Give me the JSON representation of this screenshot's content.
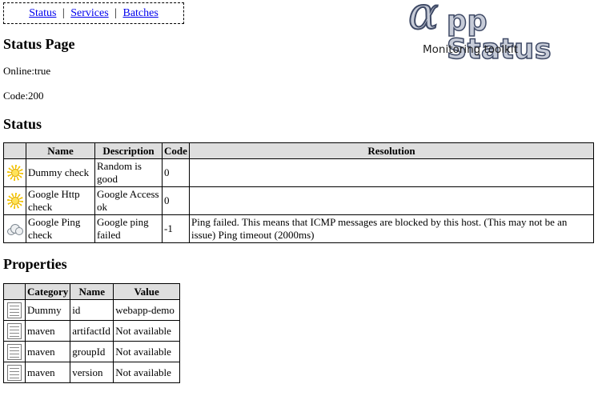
{
  "nav": {
    "links": [
      "Status",
      "Services",
      "Batches"
    ],
    "separator": "|"
  },
  "logo": {
    "alpha": "α",
    "word": "pp Status",
    "tagline": "Monitoring toolkit"
  },
  "page": {
    "title": "Status Page",
    "online": "Online:true",
    "code": "Code:200"
  },
  "status_section": {
    "heading": "Status",
    "columns": [
      "",
      "Name",
      "Description",
      "Code",
      "Resolution"
    ],
    "rows": [
      {
        "icon": "sun-icon",
        "name": "Dummy check",
        "description": "Random is good",
        "code": "0",
        "resolution": ""
      },
      {
        "icon": "sun-icon",
        "name": "Google Http check",
        "description": "Google Access ok",
        "code": "0",
        "resolution": ""
      },
      {
        "icon": "cloud-icon",
        "name": "Google Ping check",
        "description": "Google ping failed",
        "code": "-1",
        "resolution": "Ping failed. This means that ICMP messages are blocked by this host. (This may not be an issue) Ping timeout (2000ms)"
      }
    ]
  },
  "properties_section": {
    "heading": "Properties",
    "columns": [
      "",
      "Category",
      "Name",
      "Value"
    ],
    "rows": [
      {
        "icon": "document-icon",
        "category": "Dummy",
        "name": "id",
        "value": "webapp-demo"
      },
      {
        "icon": "document-icon",
        "category": "maven",
        "name": "artifactId",
        "value": "Not available"
      },
      {
        "icon": "document-icon",
        "category": "maven",
        "name": "groupId",
        "value": "Not available"
      },
      {
        "icon": "document-icon",
        "category": "maven",
        "name": "version",
        "value": "Not available"
      }
    ]
  },
  "colors": {
    "link": "#0000ee",
    "header_bg": "#dedede",
    "logo_fill": "#c7ccd8",
    "logo_stroke": "#3f4a66"
  }
}
